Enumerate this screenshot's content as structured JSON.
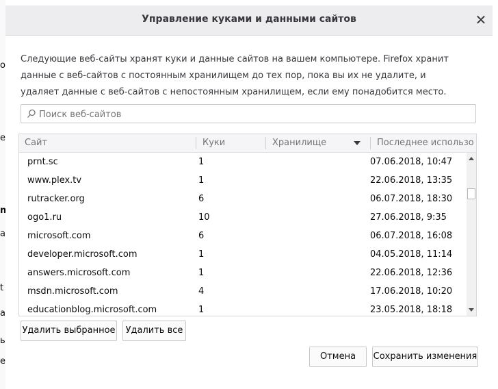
{
  "dialog": {
    "title": "Управление куками и данными сайтов",
    "close_glyph": "✕",
    "description": "Следующие веб-сайты хранят куки и данные сайтов на вашем компьютере. Firefox хранит данные с веб-сайтов с постоянным хранилищем до тех пор, пока вы их не удалите, и удаляет данные с веб-сайтов с непостоянным хранилищем, если ему понадобится место."
  },
  "search": {
    "placeholder": "Поиск веб-сайтов",
    "value": ""
  },
  "table": {
    "columns": [
      "Сайт",
      "Куки",
      "Хранилище",
      "Последнее использо..."
    ],
    "sorted_column": "Хранилище",
    "rows": [
      {
        "site": "prnt.sc",
        "cookies": "1",
        "storage": "",
        "last_used": "07.06.2018, 10:47"
      },
      {
        "site": "www.plex.tv",
        "cookies": "1",
        "storage": "",
        "last_used": "22.06.2018, 13:35"
      },
      {
        "site": "rutracker.org",
        "cookies": "6",
        "storage": "",
        "last_used": "06.07.2018, 18:30"
      },
      {
        "site": "ogo1.ru",
        "cookies": "10",
        "storage": "",
        "last_used": "27.06.2018, 9:35"
      },
      {
        "site": "microsoft.com",
        "cookies": "6",
        "storage": "",
        "last_used": "06.07.2018, 16:08"
      },
      {
        "site": "developer.microsoft.com",
        "cookies": "1",
        "storage": "",
        "last_used": "04.05.2018, 11:14"
      },
      {
        "site": "answers.microsoft.com",
        "cookies": "1",
        "storage": "",
        "last_used": "22.06.2018, 12:36"
      },
      {
        "site": "msdn.microsoft.com",
        "cookies": "4",
        "storage": "",
        "last_used": "17.06.2018, 10:20"
      },
      {
        "site": "educationblog.microsoft.com",
        "cookies": "1",
        "storage": "",
        "last_used": "23.05.2018, 18:18"
      }
    ]
  },
  "buttons": {
    "remove_selected": "Удалить выбранное",
    "remove_all": "Удалить все",
    "cancel": "Отмена",
    "save": "Сохранить изменения"
  },
  "background_fragments": [
    "o",
    "e",
    "n",
    "a",
    "t",
    "a",
    "ь",
    "e"
  ],
  "colors": {
    "header_bg": "#ededf0",
    "text": "#0c0c0d",
    "secondary_text": "#737373",
    "border": "#c8c8cc"
  }
}
